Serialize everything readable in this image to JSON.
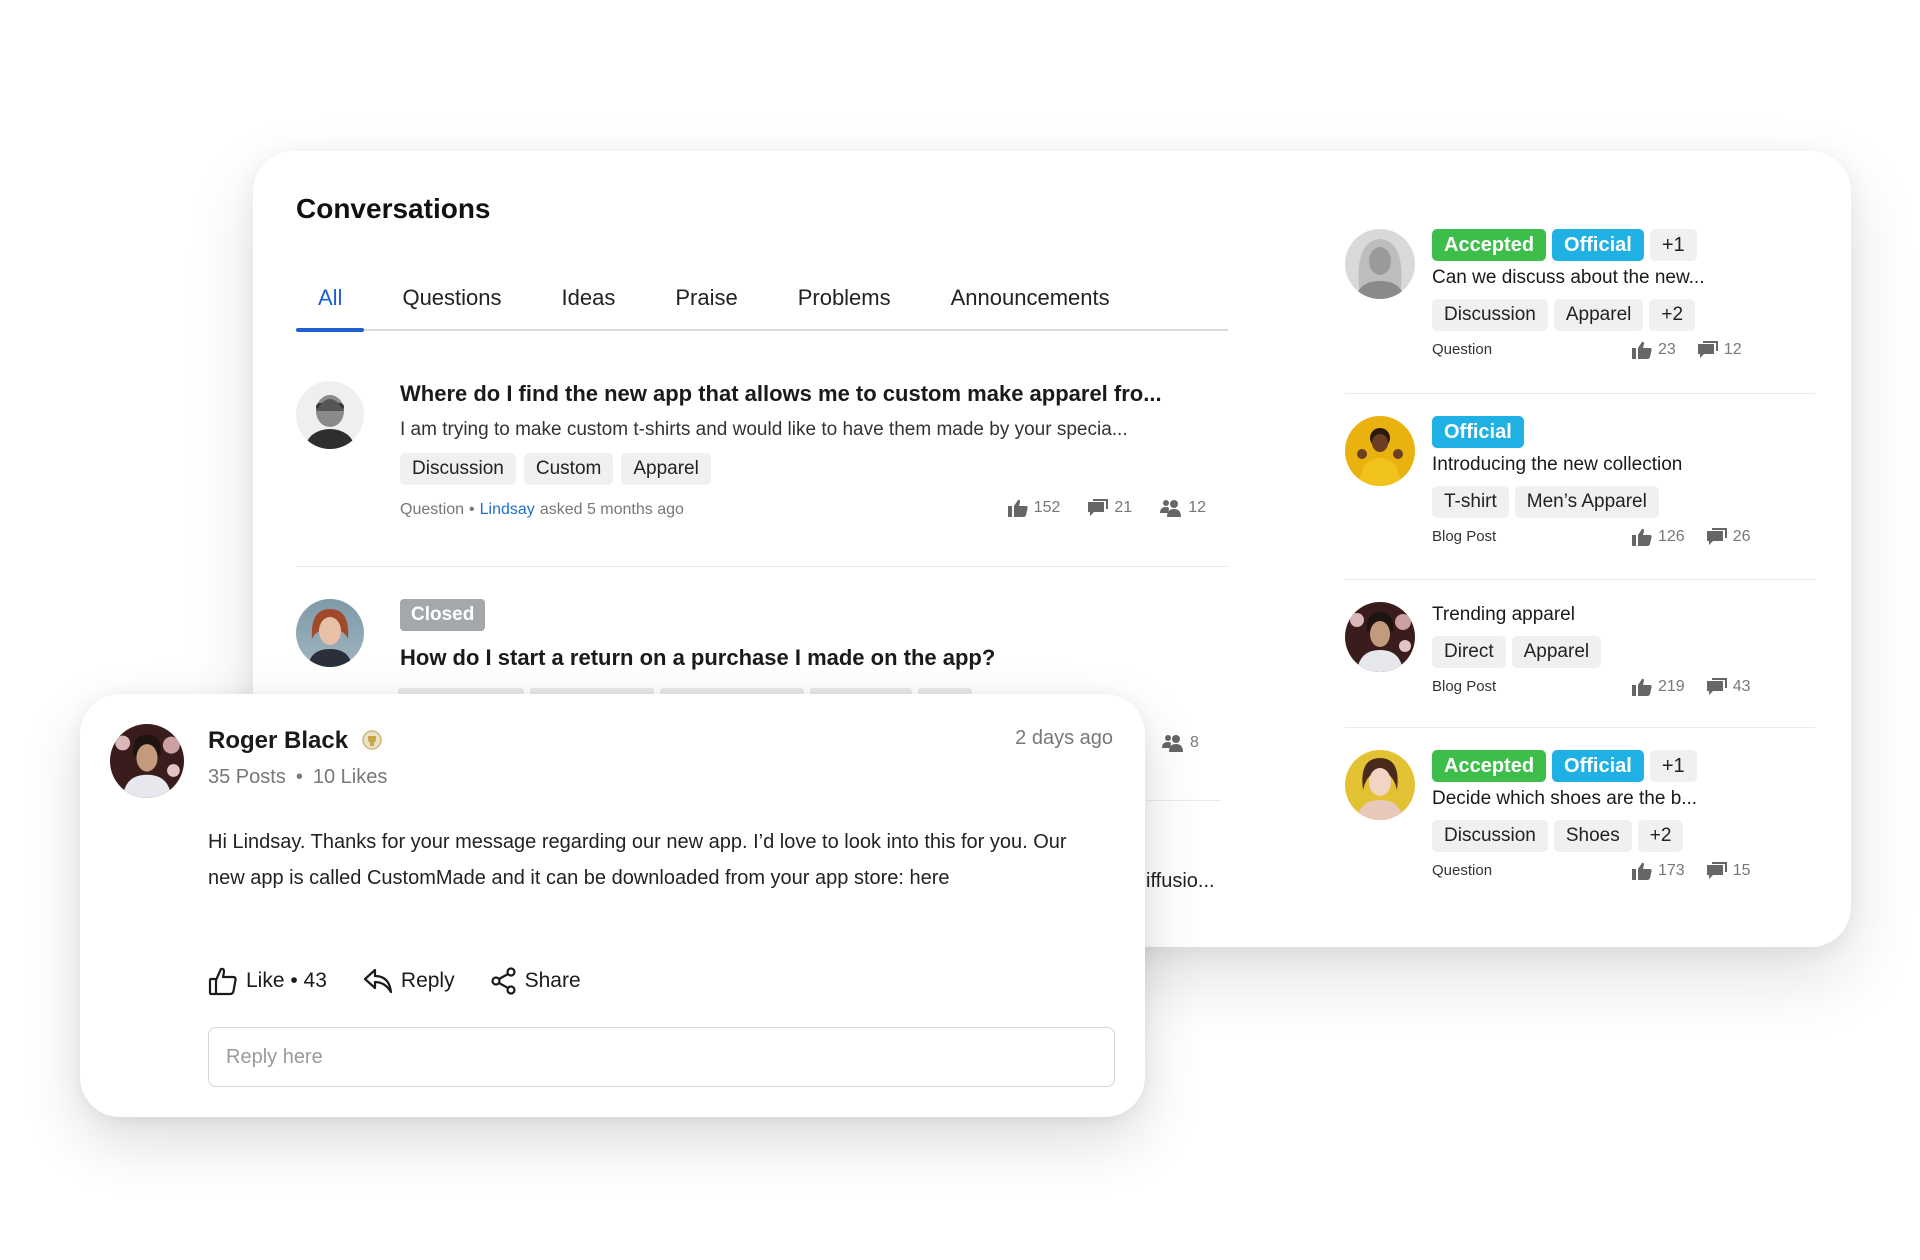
{
  "conversations": {
    "title": "Conversations",
    "tabs": [
      {
        "label": "All",
        "active": true
      },
      {
        "label": "Questions",
        "active": false
      },
      {
        "label": "Ideas",
        "active": false
      },
      {
        "label": "Praise",
        "active": false
      },
      {
        "label": "Problems",
        "active": false
      },
      {
        "label": "Announcements",
        "active": false
      }
    ],
    "posts": [
      {
        "title": "Where do I find the new app that allows me to custom make apparel fro...",
        "excerpt": "I am trying to make custom t-shirts and would like to have them made by your specia...",
        "tags": [
          "Discussion",
          "Custom",
          "Apparel"
        ],
        "type": "Question",
        "author": "Lindsay",
        "asked": "asked 5 months ago",
        "likes": "152",
        "comments": "21",
        "participants": "12"
      },
      {
        "status": "Closed",
        "title": "How do I start a return on a purchase I made on the app?",
        "participants": "8",
        "truncated_text": "iffusio..."
      }
    ]
  },
  "sidebar": {
    "items": [
      {
        "badges": [
          "Accepted",
          "Official",
          "+1"
        ],
        "title": "Can we discuss about the new...",
        "tags": [
          "Discussion",
          "Apparel",
          "+2"
        ],
        "type": "Question",
        "likes": "23",
        "comments": "12"
      },
      {
        "badges": [
          "Official"
        ],
        "title": "Introducing the new collection",
        "tags": [
          "T-shirt",
          "Men’s Apparel"
        ],
        "type": "Blog Post",
        "likes": "126",
        "comments": "26"
      },
      {
        "badges": [],
        "title": "Trending apparel",
        "tags": [
          "Direct",
          "Apparel"
        ],
        "type": "Blog Post",
        "likes": "219",
        "comments": "43"
      },
      {
        "badges": [
          "Accepted",
          "Official",
          "+1"
        ],
        "title": "Decide which shoes are the b...",
        "tags": [
          "Discussion",
          "Shoes",
          "+2"
        ],
        "type": "Question",
        "likes": "173",
        "comments": "15"
      }
    ]
  },
  "reply_card": {
    "author": "Roger Black",
    "posts": "35 Posts",
    "likes_stat": "10 Likes",
    "separator": "•",
    "time": "2 days ago",
    "message": "Hi Lindsay. Thanks for your message regarding our new app. I’d love to look into this for you. Our new app is called CustomMade and it can be downloaded from your app store: here",
    "like_label": "Like • 43",
    "reply_label": "Reply",
    "share_label": "Share",
    "reply_placeholder": "Reply here"
  },
  "colors": {
    "accent": "#1f5fcf",
    "accepted": "#3dbd4a",
    "official": "#1fb0e4",
    "closed": "#a5a8ab",
    "link": "#1f6fd0"
  }
}
